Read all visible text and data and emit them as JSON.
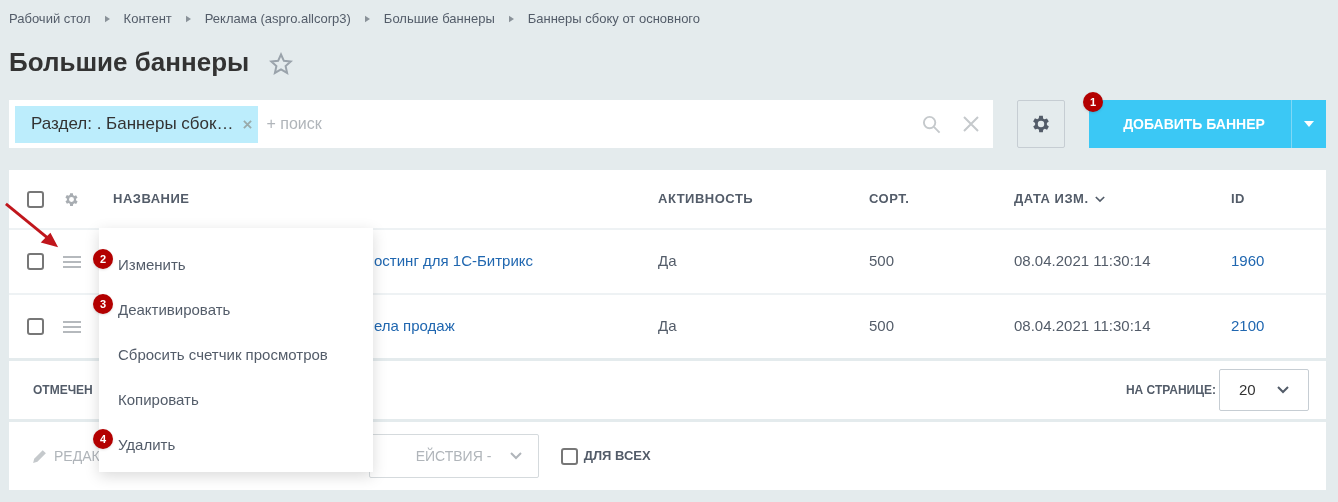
{
  "breadcrumbs": [
    "Рабочий стол",
    "Контент",
    "Реклама (aspro.allcorp3)",
    "Большие баннеры",
    "Баннеры сбоку от основного"
  ],
  "title": "Большие баннеры",
  "favorite": false,
  "filter": {
    "chip": "Раздел: . Баннеры сбок…",
    "placeholder": "+ поиск"
  },
  "add_button": {
    "label": "ДОБАВИТЬ БАННЕР",
    "badge": "1"
  },
  "table": {
    "all_checked": false,
    "columns": [
      {
        "label": "НАЗВАНИЕ",
        "sorted": false
      },
      {
        "label": "АКТИВНОСТЬ",
        "sorted": false
      },
      {
        "label": "СОРТ.",
        "sorted": false
      },
      {
        "label": "ДАТА ИЗМ.",
        "sorted": true
      },
      {
        "label": "ID",
        "sorted": false
      }
    ],
    "rows": [
      {
        "checked": false,
        "name": "остинг для 1С-Битрикс",
        "active": "Да",
        "sort": "500",
        "date": "08.04.2021 11:30:14",
        "id": "1960"
      },
      {
        "checked": false,
        "name": "ела продаж",
        "active": "Да",
        "sort": "500",
        "date": "08.04.2021 11:30:14",
        "id": "2100"
      }
    ]
  },
  "footer": {
    "selected_label": "ОТМЕЧЕН",
    "per_page_label": "НА СТРАНИЦЕ:",
    "per_page": "20"
  },
  "actions": {
    "edit": "РЕДАК",
    "select": "ЕЙСТВИЯ -",
    "for_all": {
      "label": "ДЛЯ ВСЕХ",
      "checked": false
    }
  },
  "context_menu": [
    {
      "label": "Изменить",
      "badge": "2"
    },
    {
      "label": "Деактивировать",
      "badge": "3"
    },
    {
      "label": "Сбросить счетчик просмотров"
    },
    {
      "label": "Копировать"
    },
    {
      "label": "Удалить",
      "badge": "4"
    }
  ]
}
